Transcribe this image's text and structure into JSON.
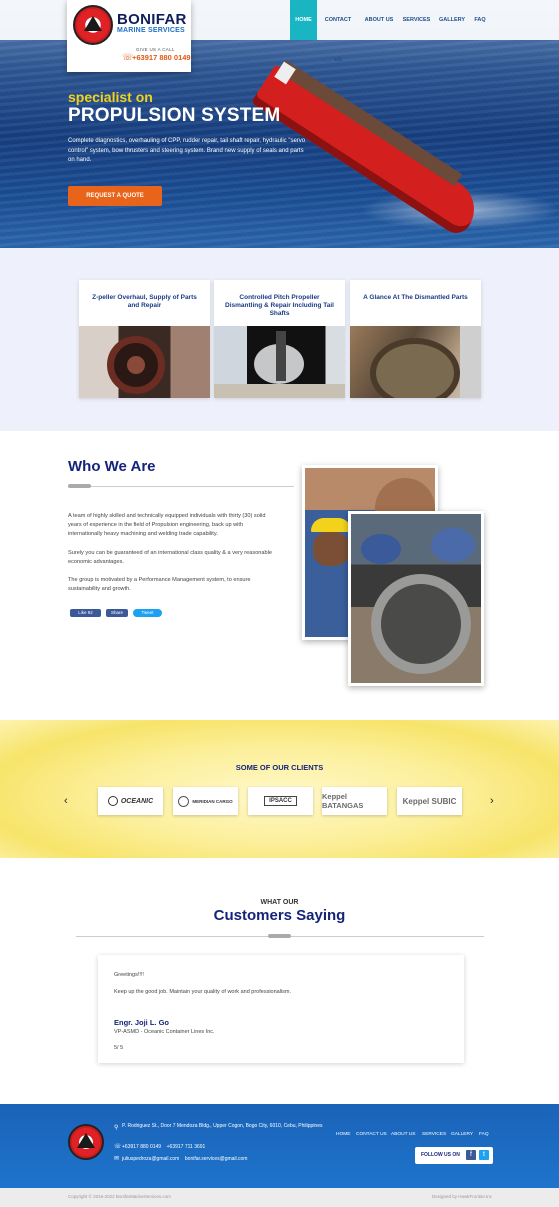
{
  "brand": {
    "name": "BONIFAR",
    "subtitle": "MARINE SERVICES",
    "call_label": "GIVE US A CALL",
    "phone": "+63917 880 0149"
  },
  "nav": {
    "items": [
      "HOME",
      "CONTACT US",
      "ABOUT US",
      "SERVICES",
      "GALLERY",
      "FAQ"
    ],
    "active": "HOME"
  },
  "hero": {
    "kicker": "specialist on",
    "title": "PROPULSION SYSTEM",
    "description": "Complete diagnostics, overhauling of CPP, rudder repair, tail shaft repair, hydraulic \"servo control\" system, bow thrusters and steering system. Brand new supply of seals and parts on hand.",
    "cta": "REQUEST A QUOTE"
  },
  "services": {
    "cards": [
      {
        "title": "Z-peller Overhaul, Supply of Parts and Repair"
      },
      {
        "title": "Controlled Pitch Propeller Dismantling & Repair Including Tail Shafts"
      },
      {
        "title": "A Glance At The Dismantled Parts"
      }
    ]
  },
  "about": {
    "title": "Who We Are",
    "paragraphs": [
      "A team of highly skilled and technically equipped individuals with thirty (30) solid years of experience in the field of Propulsion engineering, back up with internationally heavy machining and welding trade capability.",
      "Surely you can be guaranteed of an international class quality & a very reasonable economic advantages.",
      "The group is motivated by a Performance Management system, to ensure sustainability and growth."
    ],
    "social": {
      "like": "Like 92",
      "share": "Share",
      "tweet": "Tweet"
    }
  },
  "clients": {
    "title": "SOME OF OUR CLIENTS",
    "logos": [
      "OCEANIC",
      "MERIDIAN CARGO",
      "IPSACC",
      "Keppel BATANGAS",
      "Keppel SUBIC"
    ],
    "prev": "‹",
    "next": "›"
  },
  "testimonials": {
    "kicker": "WHAT OUR",
    "title": "Customers Saying",
    "greeting": "Greetings!!!!",
    "message": "Keep up the good job. Maintain your quality of work and professionalism.",
    "author": "Engr. Joji L. Go",
    "role": "VP-ASMD - Oceanic Container Lines Inc.",
    "pager": "5/ 5"
  },
  "footer": {
    "address": "P. Rodriguez St., Door 7 Mendoza Bldg., Upper Cogon, Bogo City, 6010, Cebu, Philippines",
    "phones": "+63917 880 0149    +63917 711 3691",
    "emails": "juliuspedroza@gmail.com    bonifar.services@gmail.com",
    "nav": [
      "HOME",
      "CONTACT US",
      "ABOUT US",
      "SERVICES",
      "GALLERY",
      "FAQ"
    ],
    "follow_label": "FOLLOW US ON",
    "copyright": "Copyright © 2016-2022 BonifarMarineServices.com",
    "credit": "Designed by HawkFrontier.Inc"
  },
  "colors": {
    "navy": "#15247a",
    "orange": "#e8641b",
    "teal": "#19b5c3",
    "footer_blue": "#1e6fc4",
    "yellow": "#f3d21a"
  }
}
